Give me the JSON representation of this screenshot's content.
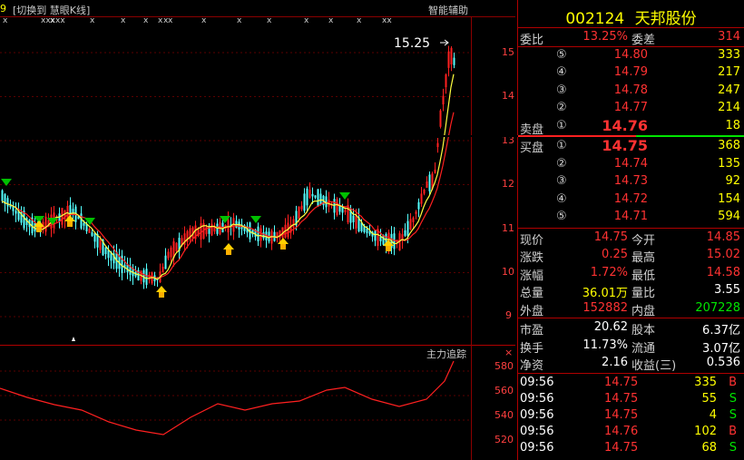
{
  "toolbar": {
    "left_mark": "9",
    "switch_label": "[切换到 慧眼K线]",
    "ai_label": "智能辅助",
    "markers": [
      "x",
      "xxx",
      "x",
      "xx",
      "x",
      "x",
      "x",
      "x",
      "x",
      "x",
      "x",
      "x",
      "x",
      "x",
      "x",
      "x",
      "xx"
    ]
  },
  "price_chart": {
    "last_price_label": "15.25",
    "axis_ticks": [
      "15",
      "14",
      "13",
      "12",
      "11",
      "10",
      "9"
    ],
    "colors": {
      "up": "#ff2020",
      "down": "#54ffff",
      "ma_short": "#ffff40",
      "ma_long": "#ff2020",
      "grid": "#8b0000"
    }
  },
  "indicator": {
    "title": "主力追踪",
    "axis_ticks": [
      "580",
      "560",
      "540",
      "520"
    ]
  },
  "quote": {
    "code": "002124",
    "name": "天邦股份",
    "weibi_label": "委比",
    "weibi_value": "13.25%",
    "weicha_label": "委差",
    "weicha_value": "314",
    "sell_label": "卖盘",
    "buy_label": "买盘",
    "sells": [
      {
        "num": "⑤",
        "price": "14.80",
        "vol": "333"
      },
      {
        "num": "④",
        "price": "14.79",
        "vol": "217"
      },
      {
        "num": "③",
        "price": "14.78",
        "vol": "247"
      },
      {
        "num": "②",
        "price": "14.77",
        "vol": "214"
      },
      {
        "num": "①",
        "price": "14.76",
        "vol": "18"
      }
    ],
    "buys": [
      {
        "num": "①",
        "price": "14.75",
        "vol": "368"
      },
      {
        "num": "②",
        "price": "14.74",
        "vol": "135"
      },
      {
        "num": "③",
        "price": "14.73",
        "vol": "92"
      },
      {
        "num": "④",
        "price": "14.72",
        "vol": "154"
      },
      {
        "num": "⑤",
        "price": "14.71",
        "vol": "594"
      }
    ],
    "stats": [
      {
        "l1": "现价",
        "v1": "14.75",
        "l2": "今开",
        "v2": "14.85",
        "c1": "red",
        "c2": "red"
      },
      {
        "l1": "涨跌",
        "v1": "0.25",
        "l2": "最高",
        "v2": "15.02",
        "c1": "red",
        "c2": "red"
      },
      {
        "l1": "涨幅",
        "v1": "1.72%",
        "l2": "最低",
        "v2": "14.58",
        "c1": "red",
        "c2": "red"
      },
      {
        "l1": "总量",
        "v1": "36.01万",
        "l2": "量比",
        "v2": "3.55",
        "c1": "yellow",
        "c2": "white"
      },
      {
        "l1": "外盘",
        "v1": "152882",
        "l2": "内盘",
        "v2": "207228",
        "c1": "red",
        "c2": "green"
      }
    ],
    "fundamentals": [
      {
        "l1": "市盈",
        "v1": "20.62",
        "l2": "股本",
        "v2": "6.37亿"
      },
      {
        "l1": "换手",
        "v1": "11.73%",
        "l2": "流通",
        "v2": "3.07亿"
      },
      {
        "l1": "净资",
        "v1": "2.16",
        "l2": "收益(三)",
        "v2": "0.536"
      }
    ],
    "ticks": [
      {
        "time": "09:56",
        "price": "14.75",
        "vol": "335",
        "side": "B"
      },
      {
        "time": "09:56",
        "price": "14.75",
        "vol": "55",
        "side": "S"
      },
      {
        "time": "09:56",
        "price": "14.75",
        "vol": "4",
        "side": "S"
      },
      {
        "time": "09:56",
        "price": "14.76",
        "vol": "102",
        "side": "B"
      },
      {
        "time": "09:56",
        "price": "14.75",
        "vol": "68",
        "side": "S"
      }
    ]
  }
}
